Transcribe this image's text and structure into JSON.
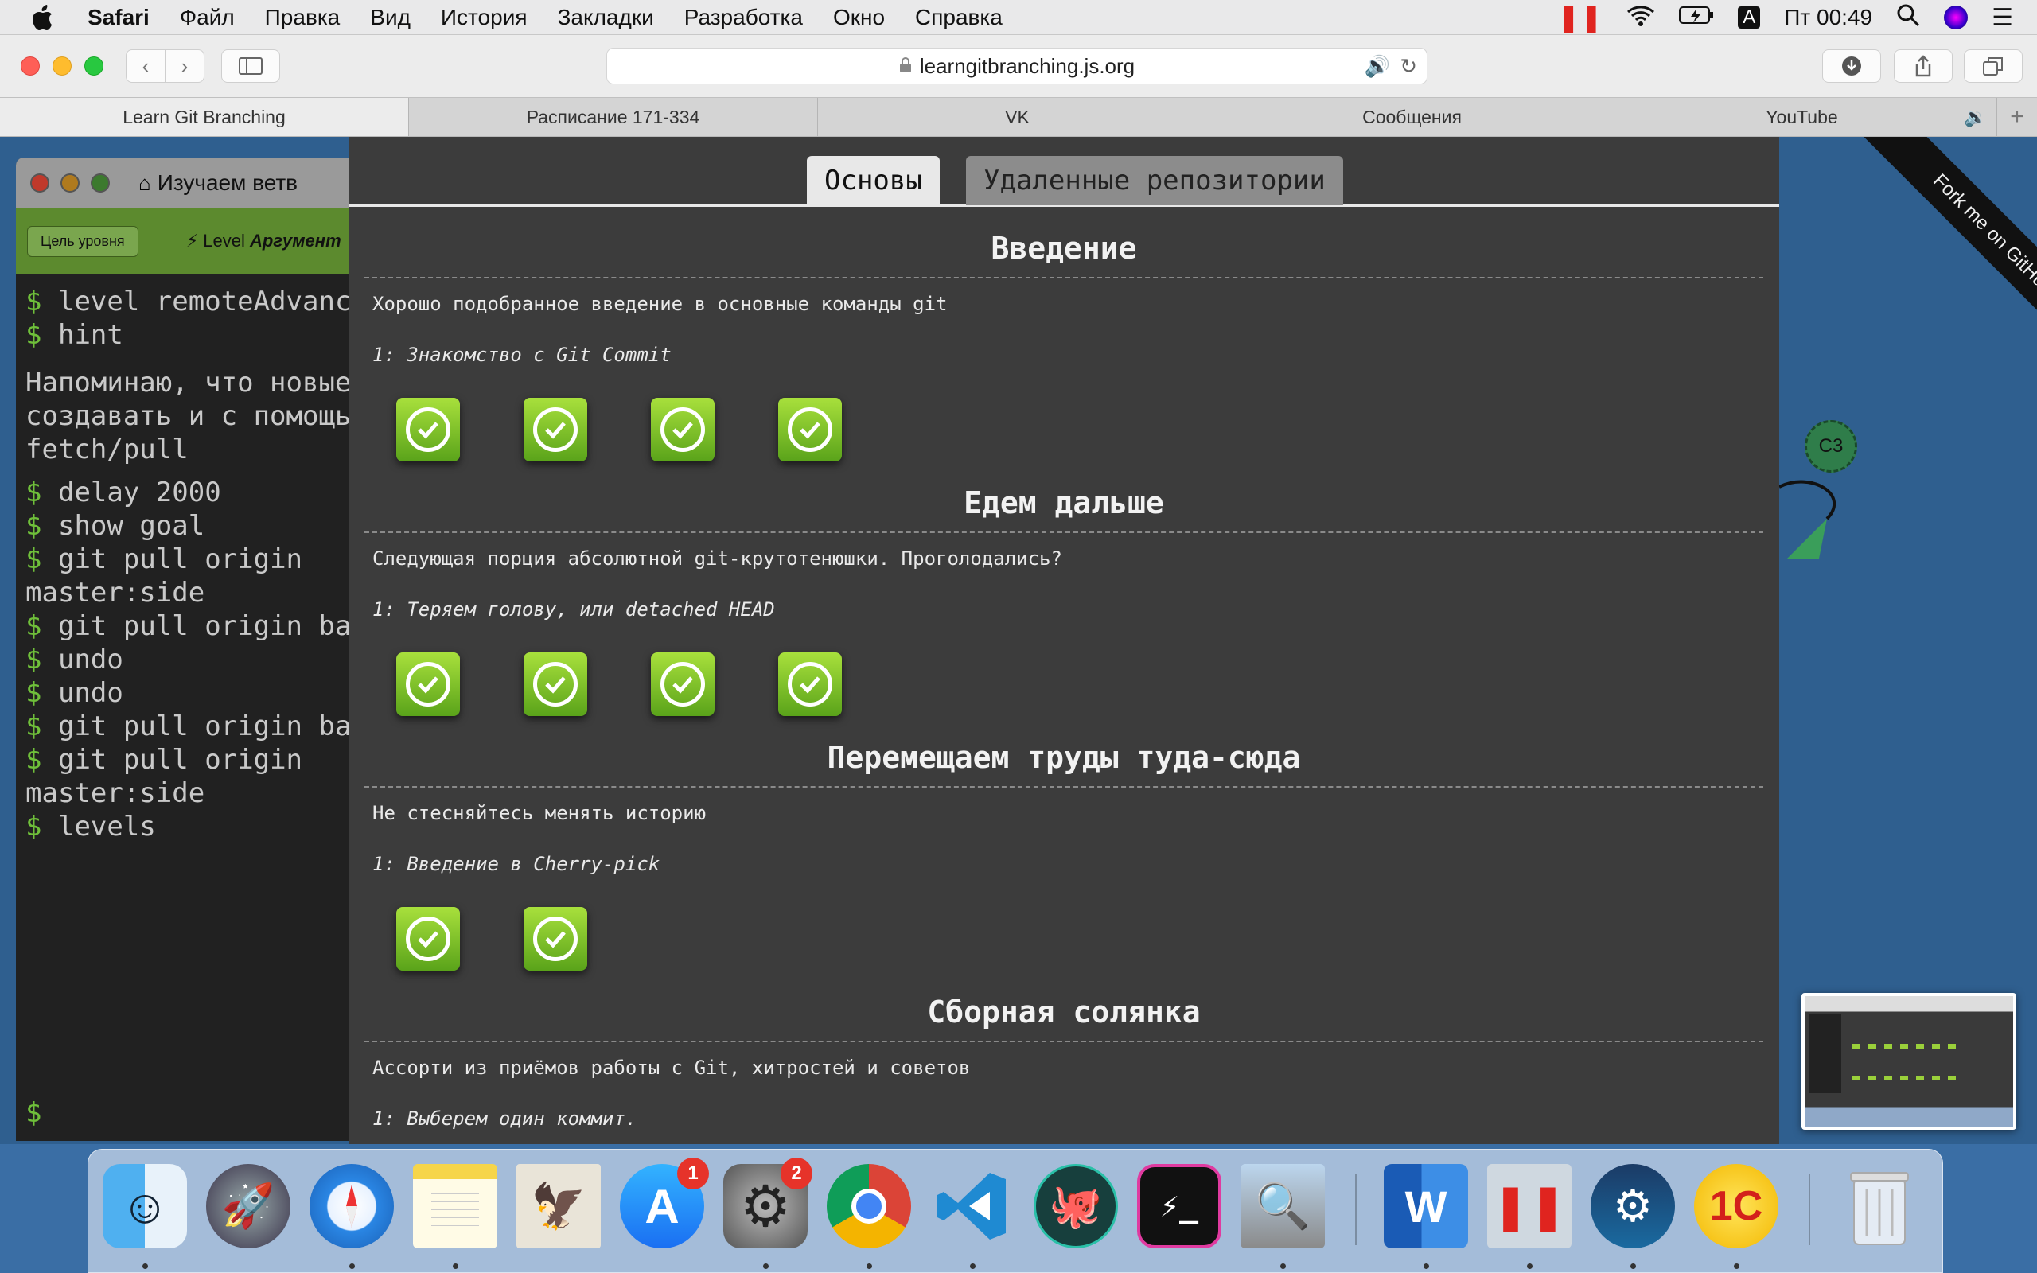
{
  "menubar": {
    "app": "Safari",
    "items": [
      "Файл",
      "Правка",
      "Вид",
      "История",
      "Закладки",
      "Разработка",
      "Окно",
      "Справка"
    ],
    "clock": "Пт 00:49",
    "input_source": "A"
  },
  "toolbar": {
    "url": "learngitbranching.js.org"
  },
  "tabs": [
    {
      "label": "Learn Git Branching"
    },
    {
      "label": "Расписание 171-334"
    },
    {
      "label": "VK"
    },
    {
      "label": "Сообщения"
    },
    {
      "label": "YouTube"
    }
  ],
  "terminal": {
    "title": "Изучаем ветв",
    "goal_button": "Цель уровня",
    "level_label": "Level",
    "level_name": "Аргумент",
    "lines": [
      {
        "prompt": true,
        "text": "level remoteAdvance"
      },
      {
        "prompt": true,
        "text": "hint"
      },
      {
        "prompt": false,
        "text": ""
      },
      {
        "prompt": false,
        "text": "Напоминаю, что новые"
      },
      {
        "prompt": false,
        "text": "создавать и с помощью"
      },
      {
        "prompt": false,
        "text": "fetch/pull"
      },
      {
        "prompt": false,
        "text": ""
      },
      {
        "prompt": true,
        "text": "delay 2000"
      },
      {
        "prompt": true,
        "text": "show goal"
      },
      {
        "prompt": true,
        "text": "git pull origin"
      },
      {
        "prompt": false,
        "text": "master:side"
      },
      {
        "prompt": true,
        "text": "git pull origin bar"
      },
      {
        "prompt": true,
        "text": "undo"
      },
      {
        "prompt": true,
        "text": "undo"
      },
      {
        "prompt": true,
        "text": "git pull origin bar"
      },
      {
        "prompt": true,
        "text": "git pull origin"
      },
      {
        "prompt": false,
        "text": "master:side"
      },
      {
        "prompt": true,
        "text": "levels"
      }
    ],
    "prompt_symbol": "$"
  },
  "modal": {
    "tabs": [
      {
        "label": "Основы",
        "active": true
      },
      {
        "label": "Удаленные репозитории",
        "active": false
      }
    ],
    "sections": [
      {
        "title": "Введение",
        "desc": "Хорошо подобранное введение в основные команды git",
        "sub": "1: Знакомство с Git Commit",
        "levels_completed": 4
      },
      {
        "title": "Едем дальше",
        "desc": "Следующая порция абсолютной git-крутотенюшки. Проголодались?",
        "sub": "1: Теряем голову, или detached HEAD",
        "levels_completed": 4
      },
      {
        "title": "Перемещаем труды туда-сюда",
        "desc": "Не стесняйтесь менять историю",
        "sub": "1: Введение в Cherry-pick",
        "levels_completed": 2
      },
      {
        "title": "Сборная солянка",
        "desc": "Ассорти из приёмов работы с Git, хитростей и советов",
        "sub": "1: Выберем один коммит.",
        "levels_completed": 0
      }
    ]
  },
  "graph": {
    "node_label": "C3"
  },
  "ribbon": {
    "text": "Fork me on GitHub"
  },
  "dock": {
    "apps": [
      {
        "name": "Finder",
        "icon": "finder-icon",
        "badge": ""
      },
      {
        "name": "Launchpad",
        "icon": "launchpad-icon",
        "badge": ""
      },
      {
        "name": "Safari",
        "icon": "safari-icon",
        "badge": ""
      },
      {
        "name": "Notes",
        "icon": "notes-icon",
        "badge": ""
      },
      {
        "name": "Mail",
        "icon": "mail-icon",
        "badge": ""
      },
      {
        "name": "App Store",
        "icon": "app-store-icon",
        "badge": "1"
      },
      {
        "name": "System Preferences",
        "icon": "system-preferences-icon",
        "badge": "2"
      },
      {
        "name": "Chrome",
        "icon": "chrome-icon",
        "badge": ""
      },
      {
        "name": "VS Code",
        "icon": "vscode-icon",
        "badge": ""
      },
      {
        "name": "GitKraken",
        "icon": "gitkraken-icon",
        "badge": ""
      },
      {
        "name": "Terminal",
        "icon": "terminal-icon",
        "badge": ""
      },
      {
        "name": "Preview",
        "icon": "preview-icon",
        "badge": ""
      },
      {
        "name": "Word",
        "icon": "word-icon",
        "badge": ""
      },
      {
        "name": "Parallels",
        "icon": "parallels-icon",
        "badge": ""
      },
      {
        "name": "Steam",
        "icon": "steam-icon",
        "badge": ""
      },
      {
        "name": "1C",
        "icon": "1c-icon",
        "badge": ""
      },
      {
        "name": "Trash",
        "icon": "trash-icon",
        "badge": ""
      }
    ]
  }
}
